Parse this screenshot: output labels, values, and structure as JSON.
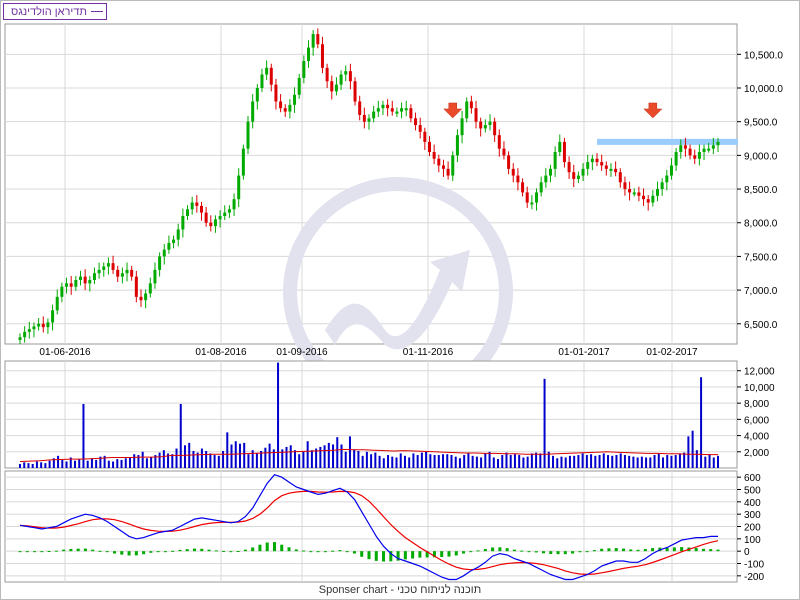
{
  "legend": {
    "label": "תדיראן הולדינגס",
    "color": "#7030a0"
  },
  "footer": {
    "text": "Sponser chart - תוכנה לניתוח טכני"
  },
  "colors": {
    "up": "#00aa00",
    "down": "#dd0000",
    "volume": "#0000cc",
    "volume_ma": "#dd0000",
    "macd": "#0000ee",
    "signal": "#ee0000",
    "hist": "#00aa00",
    "resistance": "#99ccff",
    "arrow": "#e84a2a",
    "grid": "#d8d8d8"
  },
  "chart_data": [
    {
      "type": "candlestick",
      "panel": "price",
      "x_labels": [
        "01-06-2016",
        "01-08-2016",
        "01-09-2016",
        "01-11-2016",
        "01-01-2017",
        "01-02-2017"
      ],
      "y_ticks": [
        "6,500.0",
        "7,000.0",
        "7,500.0",
        "8,000.0",
        "8,500.0",
        "9,000.0",
        "9,500.0",
        "10,000.0",
        "10,500.0"
      ],
      "ylim": [
        6200,
        10950
      ],
      "closes": [
        6300,
        6380,
        6420,
        6460,
        6500,
        6450,
        6520,
        6700,
        6900,
        7050,
        7100,
        7050,
        7150,
        7200,
        7100,
        7150,
        7250,
        7300,
        7350,
        7400,
        7300,
        7200,
        7250,
        7300,
        7200,
        6900,
        6850,
        6950,
        7100,
        7300,
        7500,
        7600,
        7700,
        7750,
        7900,
        8100,
        8200,
        8300,
        8250,
        8150,
        8000,
        7950,
        8050,
        8100,
        8150,
        8200,
        8350,
        8700,
        9100,
        9500,
        9800,
        10000,
        10200,
        10300,
        10050,
        9800,
        9700,
        9650,
        9750,
        9900,
        10150,
        10400,
        10600,
        10800,
        10650,
        10300,
        10100,
        9950,
        10050,
        10200,
        10250,
        10100,
        9800,
        9600,
        9500,
        9550,
        9650,
        9700,
        9750,
        9700,
        9650,
        9650,
        9700,
        9700,
        9550,
        9450,
        9350,
        9200,
        9050,
        8950,
        8850,
        8800,
        8700,
        9000,
        9300,
        9550,
        9800,
        9700,
        9500,
        9400,
        9450,
        9500,
        9300,
        9100,
        9000,
        8800,
        8700,
        8600,
        8450,
        8300,
        8300,
        8450,
        8600,
        8700,
        8800,
        9050,
        9200,
        8900,
        8750,
        8650,
        8700,
        8800,
        8900,
        8950,
        8900,
        8850,
        8800,
        8800,
        8750,
        8600,
        8500,
        8450,
        8450,
        8400,
        8350,
        8300,
        8400,
        8500,
        8600,
        8700,
        8850,
        9050,
        9150,
        9100,
        9000,
        8950,
        9050,
        9100,
        9100,
        9150,
        9200
      ],
      "resistance_level": 9200,
      "resistance_range": [
        124,
        150
      ],
      "sell_signals": [
        93,
        136
      ]
    },
    {
      "type": "bar",
      "panel": "volume",
      "y_ticks": [
        "2,000",
        "4,000",
        "6,000",
        "8,000",
        "10,000",
        "12,000"
      ],
      "ylim": [
        0,
        13200
      ],
      "values": [
        500,
        700,
        600,
        500,
        800,
        700,
        600,
        900,
        1200,
        1500,
        1000,
        800,
        1300,
        900,
        1100,
        7900,
        900,
        1200,
        1000,
        1400,
        1500,
        900,
        800,
        1100,
        1000,
        1200,
        1300,
        1700,
        1600,
        2000,
        1200,
        1300,
        1600,
        1900,
        2200,
        1800,
        1700,
        2400,
        7900,
        2800,
        3100,
        2100,
        1900,
        2400,
        2100,
        1800,
        1600,
        1500,
        2100,
        4400,
        2900,
        3300,
        3000,
        3100,
        1700,
        2200,
        1800,
        2100,
        2500,
        3000,
        2300,
        13000,
        2300,
        2600,
        2800,
        2200,
        1700,
        2000,
        3300,
        2200,
        2400,
        2600,
        2800,
        3100,
        2900,
        3800,
        2900,
        2000,
        3900,
        2300,
        2100,
        1500,
        2000,
        1700,
        1900,
        1500,
        1200,
        1600,
        1400,
        1300,
        1800,
        1500,
        1300,
        1800,
        1600,
        1900,
        2000,
        1700,
        1600,
        1600,
        1700,
        1700,
        1600,
        1400,
        1200,
        1600,
        1800,
        1500,
        1400,
        1300,
        1800,
        2000,
        1300,
        1100,
        1600,
        1900,
        1600,
        1700,
        1600,
        1300,
        1400,
        1800,
        1900,
        1800,
        11000,
        2000,
        1500,
        1200,
        1400,
        1300,
        1500,
        1500,
        1600,
        1800,
        1600,
        1700,
        1500,
        1600,
        1800,
        1600,
        1500,
        1600,
        1800,
        1600,
        1500,
        1400,
        1300,
        1400,
        1300,
        1300,
        1600,
        1800,
        1300,
        1600,
        1500,
        1600,
        1800,
        1900,
        3900,
        4600,
        2200,
        11200,
        1400,
        1700,
        1300,
        1500
      ],
      "moving_average": [
        800,
        850,
        900,
        1000,
        1050,
        1100,
        1100,
        1150,
        1200,
        1300,
        1300,
        1300,
        1350,
        1350,
        1400,
        1550,
        1550,
        1600,
        1650,
        1700,
        1700,
        1700,
        1750,
        1800,
        1850,
        1900,
        1950,
        2000,
        2050,
        2100,
        2150,
        2200,
        2300,
        2250,
        2250,
        2200,
        2150,
        2100,
        2150,
        2100,
        2050,
        2000,
        1950,
        1900,
        1850,
        1850,
        1800,
        1800,
        1750,
        1750,
        1700,
        1700,
        1700,
        1750,
        1800,
        1850,
        1900,
        1950,
        2000,
        1950,
        1900,
        1850,
        1800,
        1800,
        1750,
        1750,
        1700,
        1700,
        1650,
        1650
      ]
    },
    {
      "type": "line",
      "panel": "macd",
      "y_ticks": [
        "600",
        "500",
        "400",
        "300",
        "200",
        "100",
        "0",
        "-100",
        "-200"
      ],
      "ylim": [
        -250,
        650
      ],
      "series": [
        {
          "key": "macd",
          "values": [
            210,
            200,
            190,
            180,
            190,
            200,
            230,
            260,
            280,
            300,
            290,
            270,
            240,
            200,
            160,
            120,
            100,
            110,
            130,
            150,
            160,
            170,
            200,
            230,
            260,
            270,
            260,
            250,
            240,
            230,
            240,
            280,
            350,
            450,
            550,
            620,
            600,
            560,
            520,
            500,
            480,
            460,
            470,
            490,
            510,
            480,
            420,
            320,
            220,
            120,
            40,
            -20,
            -60,
            -80,
            -100,
            -120,
            -150,
            -180,
            -210,
            -230,
            -230,
            -200,
            -160,
            -130,
            -90,
            -40,
            -20,
            -30,
            -60,
            -80,
            -100,
            -130,
            -160,
            -190,
            -210,
            -230,
            -230,
            -210,
            -190,
            -160,
            -120,
            -100,
            -80,
            -80,
            -90,
            -90,
            -60,
            -20,
            10,
            30,
            60,
            90,
            100,
            110,
            110,
            120,
            120
          ]
        },
        {
          "key": "signal",
          "values": [
            210,
            205,
            198,
            190,
            186,
            188,
            195,
            208,
            222,
            240,
            255,
            262,
            262,
            255,
            240,
            220,
            198,
            180,
            168,
            162,
            160,
            162,
            170,
            183,
            200,
            215,
            225,
            232,
            234,
            234,
            236,
            245,
            265,
            300,
            350,
            410,
            450,
            470,
            480,
            485,
            485,
            480,
            478,
            480,
            485,
            484,
            475,
            450,
            405,
            345,
            280,
            215,
            160,
            110,
            70,
            30,
            -5,
            -40,
            -75,
            -105,
            -130,
            -145,
            -150,
            -148,
            -140,
            -125,
            -110,
            -100,
            -95,
            -92,
            -94,
            -100,
            -110,
            -125,
            -140,
            -160,
            -175,
            -185,
            -188,
            -185,
            -175,
            -165,
            -152,
            -140,
            -130,
            -122,
            -110,
            -92,
            -72,
            -50,
            -28,
            -5,
            15,
            35,
            55,
            72,
            85
          ]
        },
        {
          "key": "hist",
          "values": [
            0,
            -5,
            -8,
            -10,
            4,
            12,
            35,
            52,
            58,
            60,
            35,
            8,
            -22,
            -55,
            -80,
            -100,
            -98,
            -70,
            -38,
            -12,
            0,
            8,
            30,
            47,
            60,
            55,
            35,
            18,
            6,
            -4,
            4,
            35,
            85,
            150,
            200,
            210,
            150,
            90,
            40,
            15,
            -5,
            -20,
            -8,
            10,
            25,
            -4,
            -55,
            -130,
            -185,
            -225,
            -240,
            -235,
            -220,
            -190,
            -170,
            -150,
            -145,
            -140,
            -135,
            -125,
            -100,
            -55,
            -10,
            18,
            50,
            85,
            90,
            70,
            35,
            12,
            -6,
            -30,
            -50,
            -65,
            -70,
            -70,
            -55,
            -25,
            -2,
            25,
            55,
            65,
            72,
            60,
            40,
            32,
            50,
            72,
            82,
            80,
            88,
            95,
            85,
            75,
            55,
            48,
            35
          ]
        }
      ]
    }
  ]
}
